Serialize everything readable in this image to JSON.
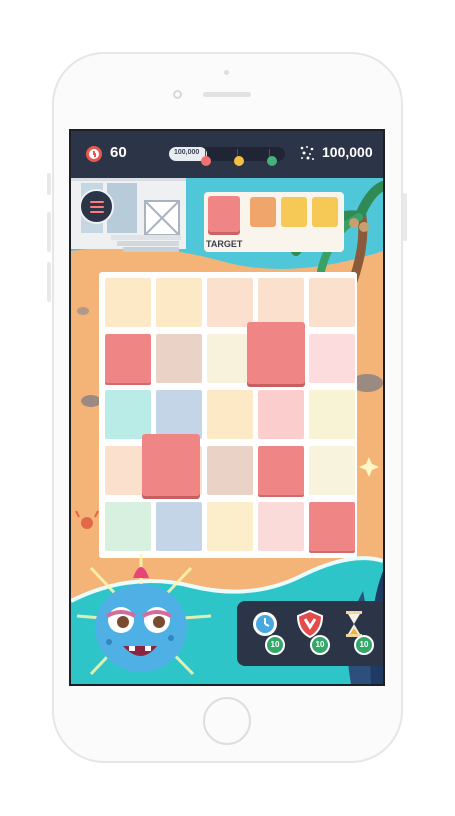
{
  "hud": {
    "time": "60",
    "progress_label": "100,000",
    "progress_fraction": 0.33,
    "score": "100,000"
  },
  "target": {
    "label": "TARGET",
    "main_color": "#f08585",
    "colors": [
      "#f0a56a",
      "#f6c956",
      "#f6c956"
    ]
  },
  "board": {
    "rows": [
      [
        "#fde9c6",
        "#fde9c6",
        "#fbe0ce",
        "#fbe0ce",
        "#fbe0ce"
      ],
      [
        "#f08585",
        "#ead2c6",
        "#f8f1dc",
        "#fbdcdc",
        "#fcdcdc"
      ],
      [
        "#b9ece6",
        "#c5d5e8",
        "#fde9c6",
        "#fbcdcd",
        "#f7f3d4"
      ],
      [
        "#fbe0ce",
        "#fbe0ce",
        "#ead2c6",
        "#f08585",
        "#f7f3dc"
      ],
      [
        "#d7f0e0",
        "#c5d5e8",
        "#fdeecb",
        "#fbdada",
        "#f08585"
      ]
    ],
    "selected_color": "#f08585"
  },
  "powerups": [
    {
      "icon": "clock-powerup-icon",
      "count": "10"
    },
    {
      "icon": "shield-powerup-icon",
      "count": "10"
    },
    {
      "icon": "hourglass-powerup-icon",
      "count": "10"
    }
  ],
  "colors": {
    "hud_bg": "#2c3447",
    "accent_red": "#e6584f",
    "dot_red": "#f27070",
    "dot_yellow": "#f4c042",
    "dot_green": "#47b07c",
    "monster": "#4fb0e6",
    "water": "#2ec5c9"
  }
}
